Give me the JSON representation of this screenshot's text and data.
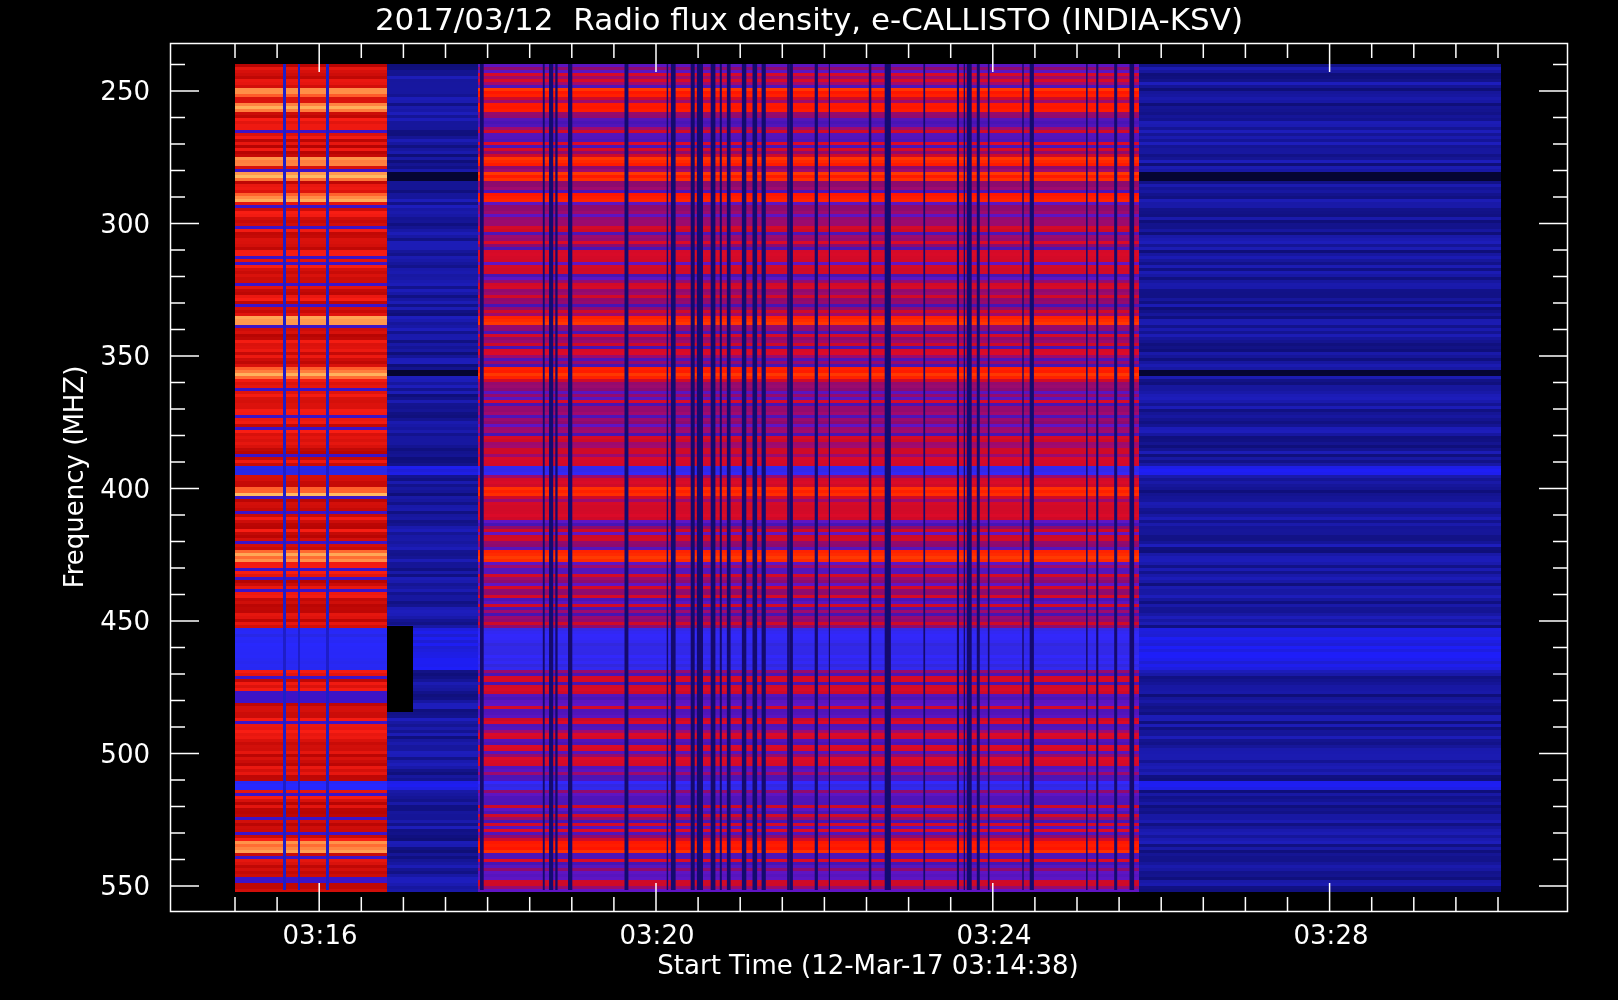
{
  "title": "2017/03/12  Radio flux density, e-CALLISTO (INDIA-KSV)",
  "y_axis": {
    "label": "Frequency (MHZ)",
    "ticks": [
      "250",
      "300",
      "350",
      "400",
      "450",
      "500",
      "550"
    ]
  },
  "x_axis": {
    "label": "Start Time (12-Mar-17 03:14:38)",
    "ticks": [
      "03:16",
      "03:20",
      "03:24",
      "03:28"
    ]
  }
}
